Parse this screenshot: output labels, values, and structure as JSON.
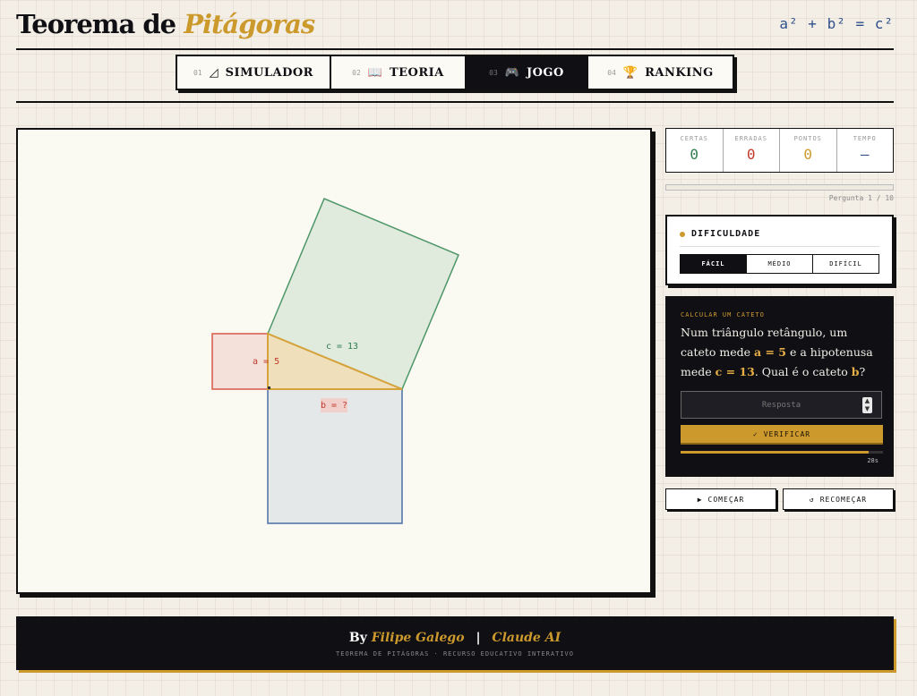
{
  "header": {
    "title_main": "Teorema de",
    "title_accent": "Pitágoras",
    "formula": "a² + b² = c²"
  },
  "nav": {
    "tabs": [
      {
        "num": "01",
        "icon": "◿",
        "label": "SIMULADOR"
      },
      {
        "num": "02",
        "icon": "📖",
        "label": "TEORIA"
      },
      {
        "num": "03",
        "icon": "🎮",
        "label": "JOGO"
      },
      {
        "num": "04",
        "icon": "🏆",
        "label": "RANKING"
      }
    ]
  },
  "canvas": {
    "label_a": "a = 5",
    "label_b": "b = ?",
    "label_c": "c = 13",
    "colors": {
      "square_a": "#d8574a",
      "square_b": "#4a6fa5",
      "square_c": "#4e9668",
      "triangle": "#d6a23a"
    }
  },
  "stats": {
    "items": [
      {
        "label": "CERTAS",
        "value": "0",
        "color": "#2e7d4f"
      },
      {
        "label": "ERRADAS",
        "value": "0",
        "color": "#c0392b"
      },
      {
        "label": "PONTOS",
        "value": "0",
        "color": "#cc992d"
      },
      {
        "label": "TEMPO",
        "value": "—",
        "color": "#2f4f8c"
      }
    ],
    "progress": 0,
    "question_counter": "Pergunta 1 / 10"
  },
  "difficulty": {
    "title": "DIFICULDADE",
    "options": [
      "FÁCIL",
      "MÉDIO",
      "DIFÍCIL"
    ]
  },
  "question": {
    "kicker": "CALCULAR UM CATETO",
    "t1": "Num triângulo retângulo, um cateto mede ",
    "v1": "a = 5",
    "t2": " e a hipotenusa mede ",
    "v2": "c = 13",
    "t3": ". Qual é o cateto ",
    "v3": "b",
    "t4": "?",
    "placeholder": "Resposta",
    "verify_label": "VERIFICAR",
    "verify_icon": "✓",
    "timer_fraction": 0.93,
    "timer_text": "28s"
  },
  "buttons": {
    "start_icon": "▶",
    "start_label": "COMEÇAR",
    "restart_icon": "↺",
    "restart_label": "RECOMEÇAR"
  },
  "footer": {
    "by": "By",
    "author": "Filipe Galego",
    "sep": "|",
    "ai": "Claude AI",
    "subtitle": "TEOREMA DE PITÁGORAS · RECURSO EDUCATIVO INTERATIVO"
  }
}
